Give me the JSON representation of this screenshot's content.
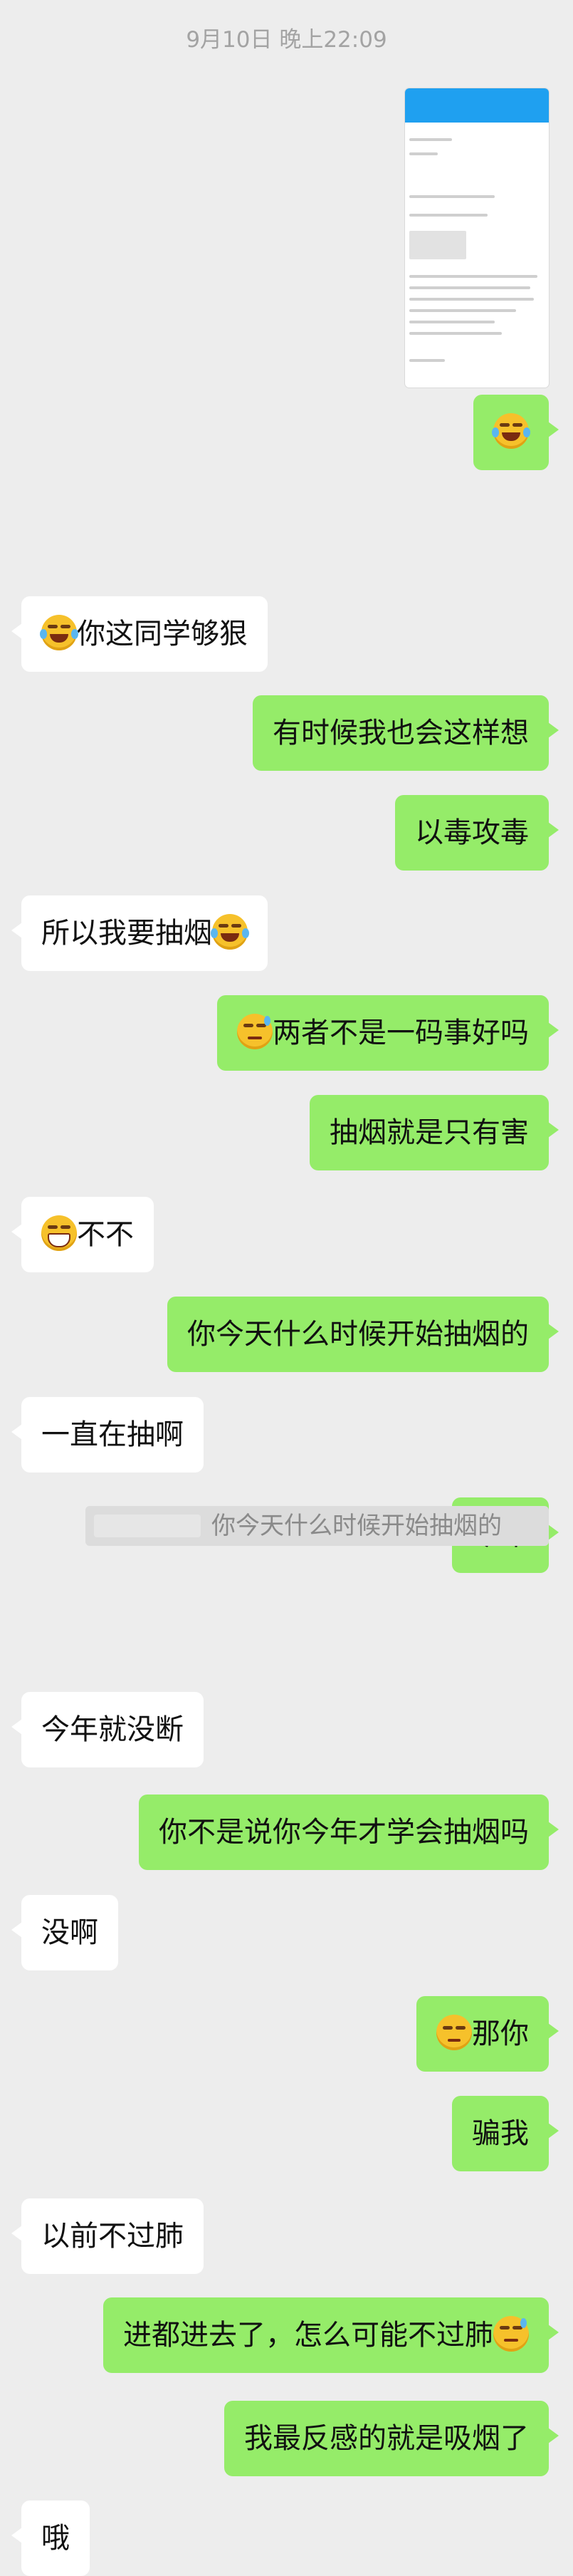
{
  "timestamp": "9月10日 晚上22:09",
  "messages": [
    {
      "side": "out",
      "emoji_before": "",
      "text": "",
      "emoji_after": "laugh-cry"
    },
    {
      "side": "in",
      "emoji_before": "laugh-cry",
      "text": "你这同学够狠",
      "emoji_after": ""
    },
    {
      "side": "out",
      "emoji_before": "",
      "text": "有时候我也会这样想",
      "emoji_after": ""
    },
    {
      "side": "out",
      "emoji_before": "",
      "text": "以毒攻毒",
      "emoji_after": ""
    },
    {
      "side": "in",
      "emoji_before": "",
      "text": "所以我要抽烟",
      "emoji_after": "laugh-cry"
    },
    {
      "side": "out",
      "emoji_before": "sweat",
      "text": "两者不是一码事好吗",
      "emoji_after": ""
    },
    {
      "side": "out",
      "emoji_before": "",
      "text": "抽烟就是只有害",
      "emoji_after": ""
    },
    {
      "side": "in",
      "emoji_before": "grin",
      "text": "不不",
      "emoji_after": ""
    },
    {
      "side": "out",
      "emoji_before": "",
      "text": "你今天什么时候开始抽烟的",
      "emoji_after": ""
    },
    {
      "side": "in",
      "emoji_before": "",
      "text": "一直在抽啊",
      "emoji_after": ""
    },
    {
      "side": "out",
      "emoji_before": "",
      "text": "今年",
      "emoji_after": ""
    },
    {
      "side": "in",
      "emoji_before": "",
      "text": "今年就没断",
      "emoji_after": ""
    },
    {
      "side": "out",
      "emoji_before": "",
      "text": "你不是说你今年才学会抽烟吗",
      "emoji_after": ""
    },
    {
      "side": "in",
      "emoji_before": "",
      "text": "没啊",
      "emoji_after": ""
    },
    {
      "side": "out",
      "emoji_before": "unamused",
      "text": "那你",
      "emoji_after": ""
    },
    {
      "side": "out",
      "emoji_before": "",
      "text": "骗我",
      "emoji_after": ""
    },
    {
      "side": "in",
      "emoji_before": "",
      "text": "以前不过肺",
      "emoji_after": ""
    },
    {
      "side": "out",
      "emoji_before": "",
      "text": "进都进去了，怎么可能不过肺",
      "emoji_after": "sweat"
    },
    {
      "side": "out",
      "emoji_before": "",
      "text": "我最反感的就是吸烟了",
      "emoji_after": ""
    },
    {
      "side": "in",
      "emoji_before": "",
      "text": "哦",
      "emoji_after": ""
    }
  ],
  "quote": {
    "text": "你今天什么时候开始抽烟的"
  }
}
